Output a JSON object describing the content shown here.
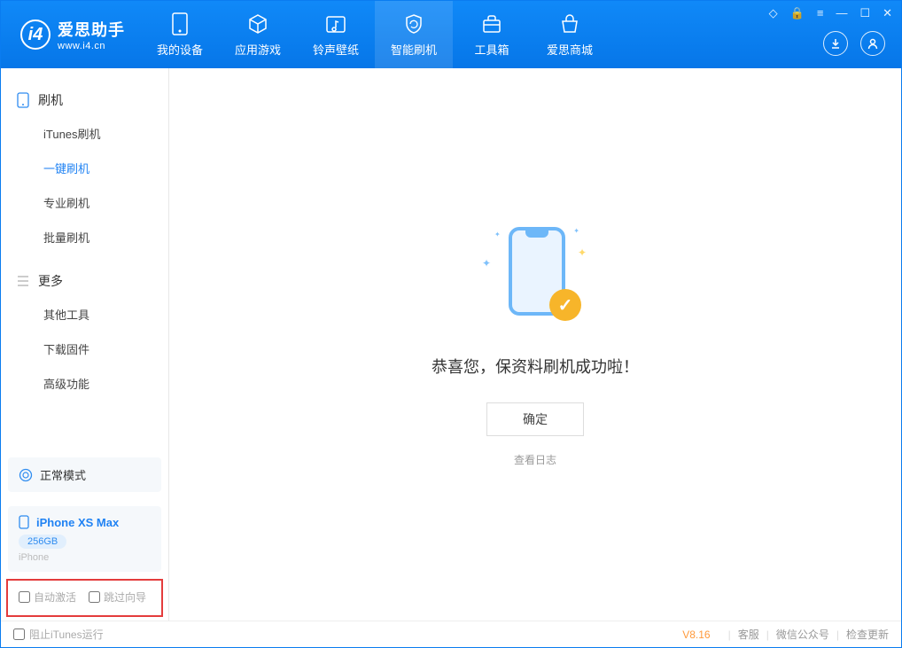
{
  "app": {
    "name": "爱思助手",
    "url": "www.i4.cn"
  },
  "nav": {
    "tabs": [
      {
        "label": "我的设备"
      },
      {
        "label": "应用游戏"
      },
      {
        "label": "铃声壁纸"
      },
      {
        "label": "智能刷机"
      },
      {
        "label": "工具箱"
      },
      {
        "label": "爱思商城"
      }
    ]
  },
  "sidebar": {
    "group_flash": "刷机",
    "group_more": "更多",
    "items_flash": [
      {
        "label": "iTunes刷机"
      },
      {
        "label": "一键刷机"
      },
      {
        "label": "专业刷机"
      },
      {
        "label": "批量刷机"
      }
    ],
    "items_more": [
      {
        "label": "其他工具"
      },
      {
        "label": "下载固件"
      },
      {
        "label": "高级功能"
      }
    ],
    "mode": "正常模式",
    "device": {
      "name": "iPhone XS Max",
      "capacity": "256GB",
      "type": "iPhone"
    },
    "cb_auto_activate": "自动激活",
    "cb_skip_guide": "跳过向导"
  },
  "main": {
    "success": "恭喜您，保资料刷机成功啦！",
    "ok": "确定",
    "view_log": "查看日志"
  },
  "footer": {
    "block_itunes": "阻止iTunes运行",
    "version": "V8.16",
    "links": {
      "service": "客服",
      "wechat": "微信公众号",
      "update": "检查更新"
    }
  }
}
